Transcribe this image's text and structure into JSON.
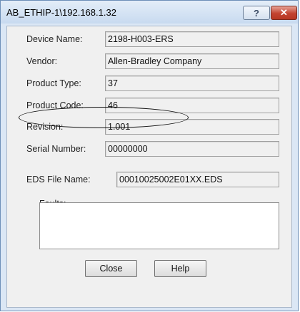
{
  "window": {
    "title": "AB_ETHIP-1\\192.168.1.32",
    "help_button": "?",
    "close_button": "✕"
  },
  "fields": {
    "device_name": {
      "label": "Device Name:",
      "value": "2198-H003-ERS"
    },
    "vendor": {
      "label": "Vendor:",
      "value": "Allen-Bradley Company"
    },
    "product_type": {
      "label": "Product Type:",
      "value": "37"
    },
    "product_code": {
      "label": "Product Code:",
      "value": "46"
    },
    "revision": {
      "label": "Revision:",
      "value": "1.001"
    },
    "serial_number": {
      "label": "Serial Number:",
      "value": "00000000"
    },
    "eds_file_name": {
      "label": "EDS File Name:",
      "value": "00010025002E01XX.EDS"
    }
  },
  "faults": {
    "label": "Faults:",
    "value": ""
  },
  "buttons": {
    "close": "Close",
    "help": "Help"
  },
  "colors": {
    "titlebar": "#c8daf0",
    "close_button": "#c24330",
    "dialog_bg": "#f0f0f0"
  }
}
